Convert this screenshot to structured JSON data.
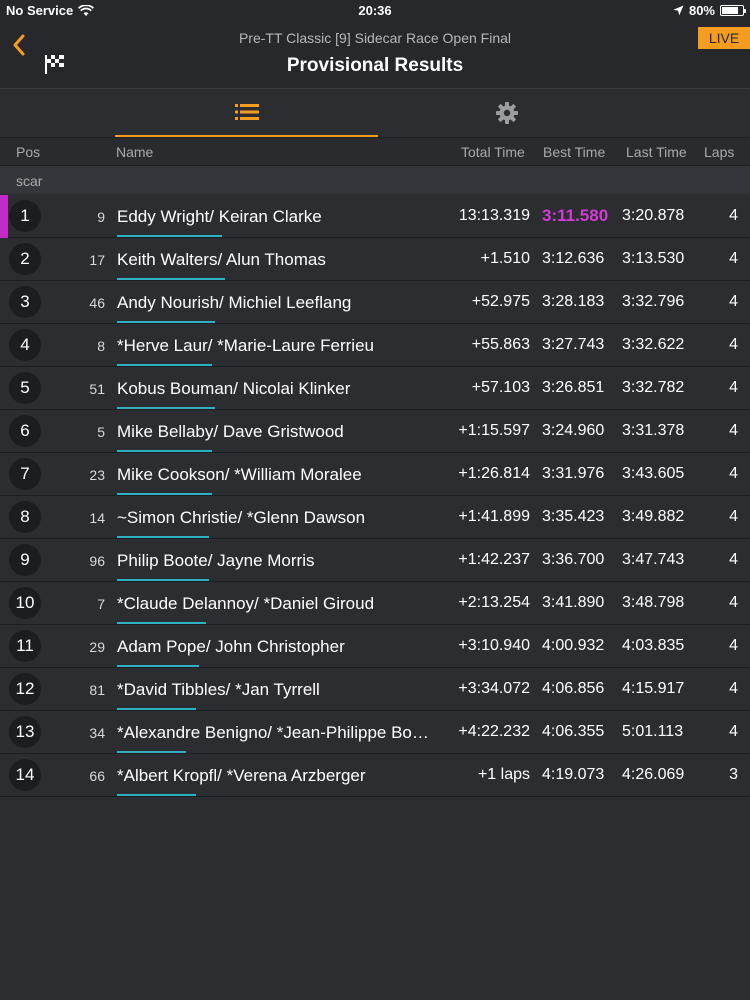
{
  "status": {
    "carrier": "No Service",
    "time": "20:36",
    "battery": "80%",
    "battery_level": 0.8
  },
  "nav": {
    "subtitle": "Pre-TT Classic [9] Sidecar Race Open Final",
    "title": "Provisional Results",
    "live_label": "LIVE"
  },
  "header": {
    "pos": "Pos",
    "name": "Name",
    "total": "Total Time",
    "best": "Best Time",
    "last": "Last Time",
    "laps": "Laps"
  },
  "section_label": "scar",
  "colors": {
    "accent": "#f39c1f",
    "fastest": "#d33ad6",
    "progress": "#2eb1c2"
  },
  "results": [
    {
      "pos": "1",
      "num": "9",
      "name": "Eddy Wright/ Keiran Clarke",
      "total": "13:13.319",
      "best": "3:11.580",
      "last": "3:20.878",
      "laps": "4",
      "fastest": true,
      "progress": 0.32
    },
    {
      "pos": "2",
      "num": "17",
      "name": "Keith Walters/ Alun  Thomas",
      "total": "+1.510",
      "best": "3:12.636",
      "last": "3:13.530",
      "laps": "4",
      "progress": 0.33
    },
    {
      "pos": "3",
      "num": "46",
      "name": "Andy Nourish/ Michiel Leeflang",
      "total": "+52.975",
      "best": "3:28.183",
      "last": "3:32.796",
      "laps": "4",
      "progress": 0.3
    },
    {
      "pos": "4",
      "num": "8",
      "name": "*Herve Laur/ *Marie-Laure Ferrieu",
      "total": "+55.863",
      "best": "3:27.743",
      "last": "3:32.622",
      "laps": "4",
      "progress": 0.29
    },
    {
      "pos": "5",
      "num": "51",
      "name": "Kobus Bouman/ Nicolai Klinker",
      "total": "+57.103",
      "best": "3:26.851",
      "last": "3:32.782",
      "laps": "4",
      "progress": 0.3
    },
    {
      "pos": "6",
      "num": "5",
      "name": "Mike Bellaby/ Dave Gristwood",
      "total": "+1:15.597",
      "best": "3:24.960",
      "last": "3:31.378",
      "laps": "4",
      "progress": 0.29
    },
    {
      "pos": "7",
      "num": "23",
      "name": "Mike Cookson/ *William Moralee",
      "total": "+1:26.814",
      "best": "3:31.976",
      "last": "3:43.605",
      "laps": "4",
      "progress": 0.29
    },
    {
      "pos": "8",
      "num": "14",
      "name": "~Simon Christie/ *Glenn Dawson",
      "total": "+1:41.899",
      "best": "3:35.423",
      "last": "3:49.882",
      "laps": "4",
      "progress": 0.28
    },
    {
      "pos": "9",
      "num": "96",
      "name": "Philip Boote/ Jayne Morris",
      "total": "+1:42.237",
      "best": "3:36.700",
      "last": "3:47.743",
      "laps": "4",
      "progress": 0.28
    },
    {
      "pos": "10",
      "num": "7",
      "name": "*Claude Delannoy/ *Daniel Giroud",
      "total": "+2:13.254",
      "best": "3:41.890",
      "last": "3:48.798",
      "laps": "4",
      "progress": 0.27
    },
    {
      "pos": "11",
      "num": "29",
      "name": "Adam Pope/ John Christopher",
      "total": "+3:10.940",
      "best": "4:00.932",
      "last": "4:03.835",
      "laps": "4",
      "progress": 0.25
    },
    {
      "pos": "12",
      "num": "81",
      "name": "*David Tibbles/ *Jan Tyrrell",
      "total": "+3:34.072",
      "best": "4:06.856",
      "last": "4:15.917",
      "laps": "4",
      "progress": 0.24
    },
    {
      "pos": "13",
      "num": "34",
      "name": "*Alexandre Benigno/ *Jean-Philippe Bo…",
      "total": "+4:22.232",
      "best": "4:06.355",
      "last": "5:01.113",
      "laps": "4",
      "progress": 0.21
    },
    {
      "pos": "14",
      "num": "66",
      "name": "*Albert Kropfl/ *Verena Arzberger",
      "total": "+1 laps",
      "best": "4:19.073",
      "last": "4:26.069",
      "laps": "3",
      "progress": 0.24
    }
  ]
}
